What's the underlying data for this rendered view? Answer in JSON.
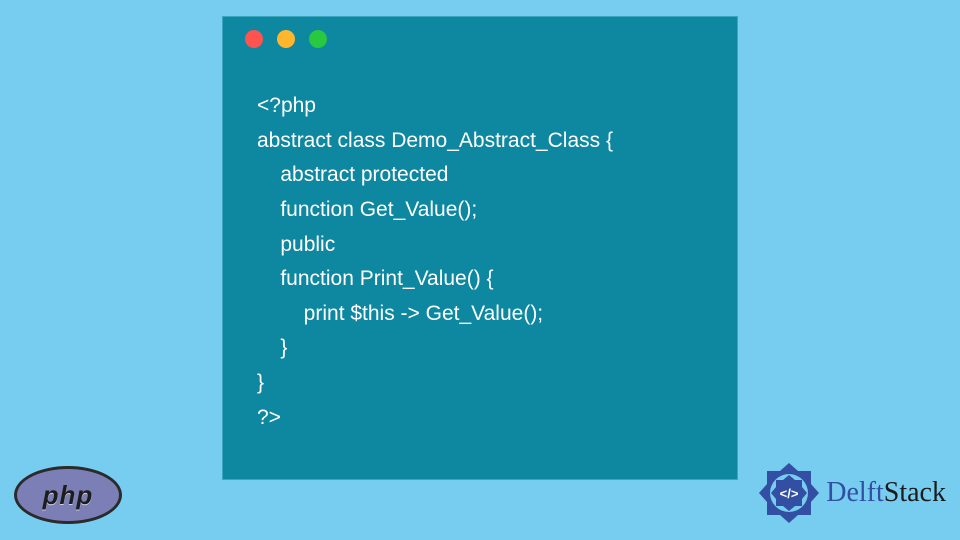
{
  "code": {
    "lines": [
      "<?php",
      "abstract class Demo_Abstract_Class {",
      "    abstract protected",
      "    function Get_Value();",
      "    public",
      "    function Print_Value() {",
      "        print $this -> Get_Value();",
      "    }",
      "}",
      "?>"
    ]
  },
  "php_logo": {
    "text": "php"
  },
  "delft": {
    "brand_first": "Delft",
    "brand_second": "Stack",
    "glyph": "</>"
  },
  "dots": {
    "red": "#ff534f",
    "yellow": "#ffb62c",
    "green": "#28c840"
  }
}
